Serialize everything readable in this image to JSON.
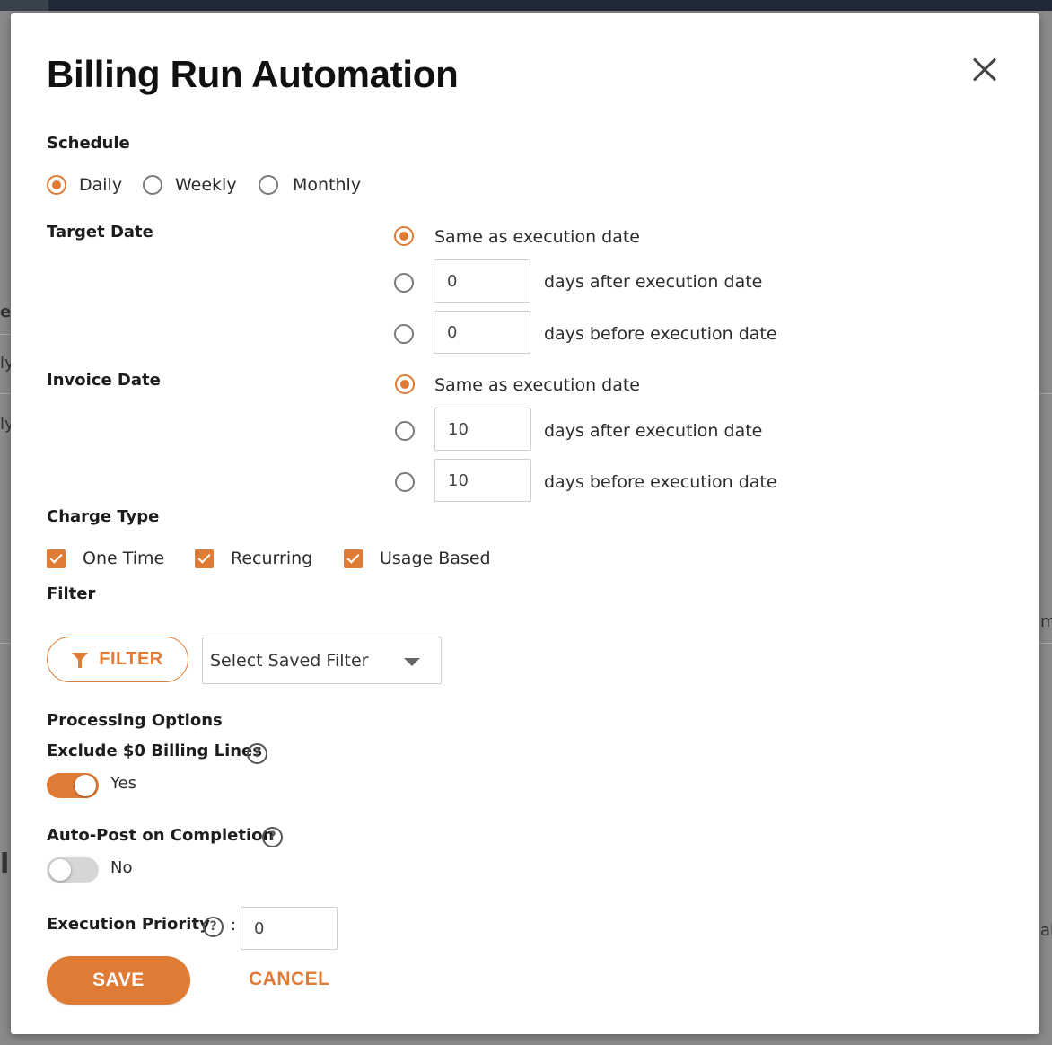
{
  "dialog": {
    "title": "Billing Run Automation"
  },
  "schedule": {
    "label": "Schedule",
    "options": [
      "Daily",
      "Weekly",
      "Monthly"
    ],
    "selected": "Daily"
  },
  "target_date": {
    "label": "Target Date",
    "same_label": "Same as execution date",
    "after_value": "0",
    "after_label": "days after execution date",
    "before_value": "0",
    "before_label": "days before execution date"
  },
  "invoice_date": {
    "label": "Invoice Date",
    "same_label": "Same as execution date",
    "after_value": "10",
    "after_label": "days after execution date",
    "before_value": "10",
    "before_label": "days before execution date"
  },
  "charge_type": {
    "label": "Charge Type",
    "options": [
      "One Time",
      "Recurring",
      "Usage Based"
    ]
  },
  "filter": {
    "label": "Filter",
    "button_label": "FILTER",
    "saved_filter": "Select Saved Filter"
  },
  "processing": {
    "label": "Processing Options",
    "exclude_label": "Exclude $0 Billing Lines",
    "exclude_state": "Yes",
    "autopost_label": "Auto-Post on Completion",
    "autopost_state": "No",
    "priority_label": "Execution Priority",
    "priority_colon": ":",
    "priority_value": "0",
    "help_glyph": "?"
  },
  "actions": {
    "save": "SAVE",
    "cancel": "CANCEL"
  },
  "background_fragments": [
    "e",
    "ly",
    "ly",
    "m",
    "l",
    "al"
  ],
  "colors": {
    "accent": "#e07b35",
    "overlay": "#8a8a8a"
  }
}
